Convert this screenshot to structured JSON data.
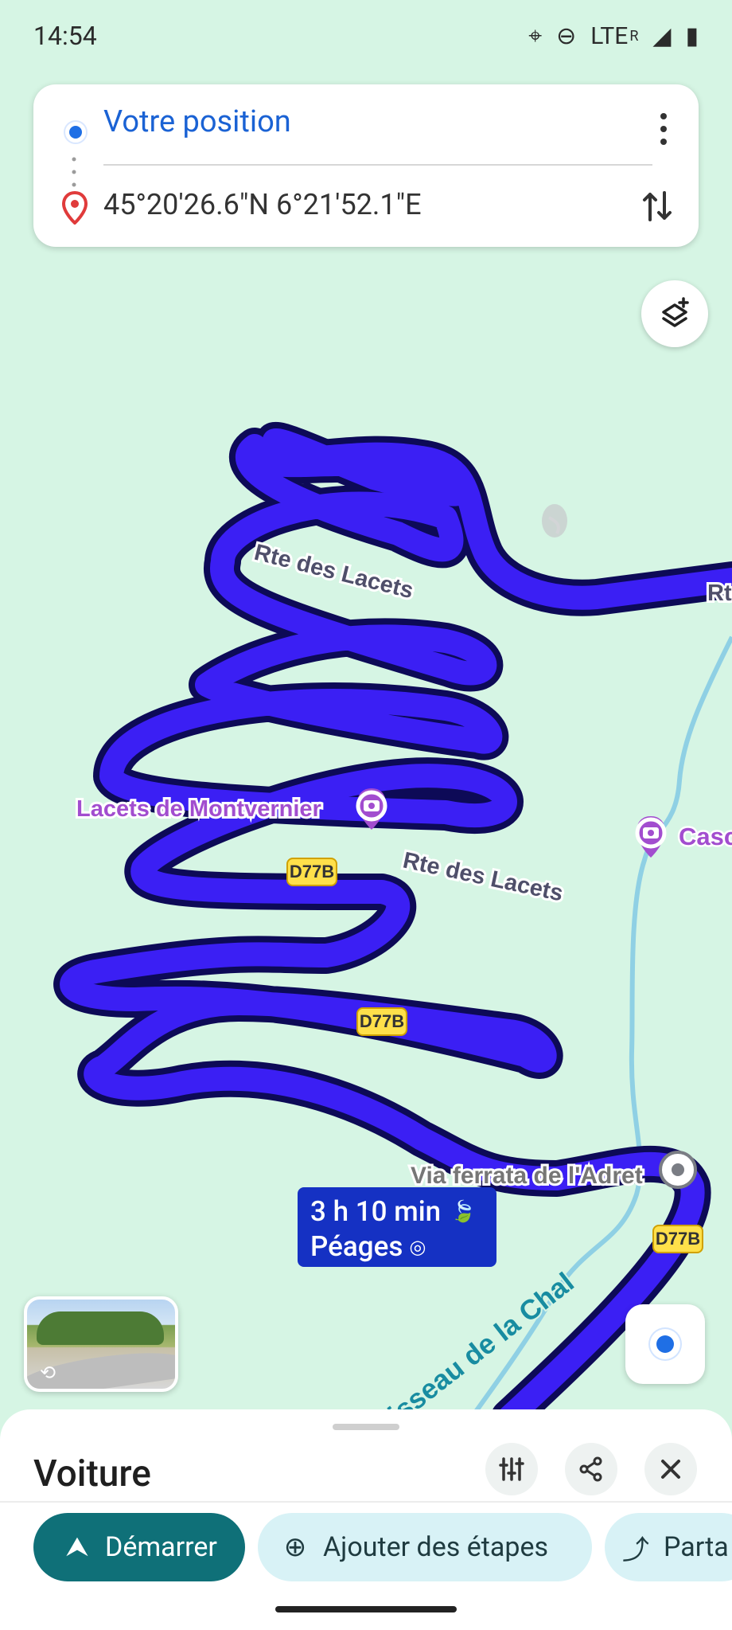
{
  "status_bar": {
    "time": "14:54",
    "location_icon": "location-icon",
    "dnd_icon": "do-not-disturb-icon",
    "network": "LTE",
    "roaming": "R",
    "signal_icon": "signal-icon",
    "battery_icon": "battery-icon"
  },
  "route_card": {
    "origin": "Votre position",
    "destination": "45°20'26.6\"N 6°21'52.1\"E",
    "more_icon": "more-vertical-icon",
    "swap_icon": "swap-vertical-icon"
  },
  "map": {
    "labels": {
      "road_top": "Rte des Lacets",
      "road_top_right": "Rte",
      "landmark": "Lacets de Montvernier",
      "right_poi": "Casc",
      "road_middle": "Rte des Lacets",
      "shield_1": "D77B",
      "shield_2": "D77B",
      "shield_3": "D77B",
      "via_ferrata": "Via ferrata de l'Adret",
      "stream": "isseau de la Chal"
    },
    "route_info": {
      "time": "3 h 10 min",
      "tolls": "Péages"
    },
    "colors": {
      "background": "#d6f5e4",
      "route": "#3b1ff4",
      "route_outline": "#0d0a57",
      "river": "#8fd0e4",
      "poi": "#a24dcf"
    }
  },
  "bottom_sheet": {
    "mode": "Voiture",
    "filter_icon": "sliders-icon",
    "share_icon": "share-icon",
    "close_icon": "close-icon",
    "start_label": "Démarrer",
    "add_stops_label": "Ajouter des étapes",
    "share_label": "Parta"
  }
}
